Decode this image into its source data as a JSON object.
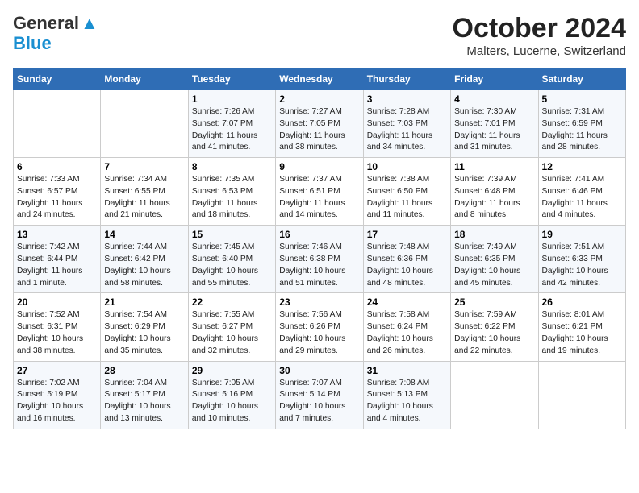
{
  "header": {
    "logo_line1": "General",
    "logo_line2": "Blue",
    "month": "October 2024",
    "location": "Malters, Lucerne, Switzerland"
  },
  "weekdays": [
    "Sunday",
    "Monday",
    "Tuesday",
    "Wednesday",
    "Thursday",
    "Friday",
    "Saturday"
  ],
  "weeks": [
    [
      {
        "num": "",
        "info": ""
      },
      {
        "num": "",
        "info": ""
      },
      {
        "num": "1",
        "info": "Sunrise: 7:26 AM\nSunset: 7:07 PM\nDaylight: 11 hours and 41 minutes."
      },
      {
        "num": "2",
        "info": "Sunrise: 7:27 AM\nSunset: 7:05 PM\nDaylight: 11 hours and 38 minutes."
      },
      {
        "num": "3",
        "info": "Sunrise: 7:28 AM\nSunset: 7:03 PM\nDaylight: 11 hours and 34 minutes."
      },
      {
        "num": "4",
        "info": "Sunrise: 7:30 AM\nSunset: 7:01 PM\nDaylight: 11 hours and 31 minutes."
      },
      {
        "num": "5",
        "info": "Sunrise: 7:31 AM\nSunset: 6:59 PM\nDaylight: 11 hours and 28 minutes."
      }
    ],
    [
      {
        "num": "6",
        "info": "Sunrise: 7:33 AM\nSunset: 6:57 PM\nDaylight: 11 hours and 24 minutes."
      },
      {
        "num": "7",
        "info": "Sunrise: 7:34 AM\nSunset: 6:55 PM\nDaylight: 11 hours and 21 minutes."
      },
      {
        "num": "8",
        "info": "Sunrise: 7:35 AM\nSunset: 6:53 PM\nDaylight: 11 hours and 18 minutes."
      },
      {
        "num": "9",
        "info": "Sunrise: 7:37 AM\nSunset: 6:51 PM\nDaylight: 11 hours and 14 minutes."
      },
      {
        "num": "10",
        "info": "Sunrise: 7:38 AM\nSunset: 6:50 PM\nDaylight: 11 hours and 11 minutes."
      },
      {
        "num": "11",
        "info": "Sunrise: 7:39 AM\nSunset: 6:48 PM\nDaylight: 11 hours and 8 minutes."
      },
      {
        "num": "12",
        "info": "Sunrise: 7:41 AM\nSunset: 6:46 PM\nDaylight: 11 hours and 4 minutes."
      }
    ],
    [
      {
        "num": "13",
        "info": "Sunrise: 7:42 AM\nSunset: 6:44 PM\nDaylight: 11 hours and 1 minute."
      },
      {
        "num": "14",
        "info": "Sunrise: 7:44 AM\nSunset: 6:42 PM\nDaylight: 10 hours and 58 minutes."
      },
      {
        "num": "15",
        "info": "Sunrise: 7:45 AM\nSunset: 6:40 PM\nDaylight: 10 hours and 55 minutes."
      },
      {
        "num": "16",
        "info": "Sunrise: 7:46 AM\nSunset: 6:38 PM\nDaylight: 10 hours and 51 minutes."
      },
      {
        "num": "17",
        "info": "Sunrise: 7:48 AM\nSunset: 6:36 PM\nDaylight: 10 hours and 48 minutes."
      },
      {
        "num": "18",
        "info": "Sunrise: 7:49 AM\nSunset: 6:35 PM\nDaylight: 10 hours and 45 minutes."
      },
      {
        "num": "19",
        "info": "Sunrise: 7:51 AM\nSunset: 6:33 PM\nDaylight: 10 hours and 42 minutes."
      }
    ],
    [
      {
        "num": "20",
        "info": "Sunrise: 7:52 AM\nSunset: 6:31 PM\nDaylight: 10 hours and 38 minutes."
      },
      {
        "num": "21",
        "info": "Sunrise: 7:54 AM\nSunset: 6:29 PM\nDaylight: 10 hours and 35 minutes."
      },
      {
        "num": "22",
        "info": "Sunrise: 7:55 AM\nSunset: 6:27 PM\nDaylight: 10 hours and 32 minutes."
      },
      {
        "num": "23",
        "info": "Sunrise: 7:56 AM\nSunset: 6:26 PM\nDaylight: 10 hours and 29 minutes."
      },
      {
        "num": "24",
        "info": "Sunrise: 7:58 AM\nSunset: 6:24 PM\nDaylight: 10 hours and 26 minutes."
      },
      {
        "num": "25",
        "info": "Sunrise: 7:59 AM\nSunset: 6:22 PM\nDaylight: 10 hours and 22 minutes."
      },
      {
        "num": "26",
        "info": "Sunrise: 8:01 AM\nSunset: 6:21 PM\nDaylight: 10 hours and 19 minutes."
      }
    ],
    [
      {
        "num": "27",
        "info": "Sunrise: 7:02 AM\nSunset: 5:19 PM\nDaylight: 10 hours and 16 minutes."
      },
      {
        "num": "28",
        "info": "Sunrise: 7:04 AM\nSunset: 5:17 PM\nDaylight: 10 hours and 13 minutes."
      },
      {
        "num": "29",
        "info": "Sunrise: 7:05 AM\nSunset: 5:16 PM\nDaylight: 10 hours and 10 minutes."
      },
      {
        "num": "30",
        "info": "Sunrise: 7:07 AM\nSunset: 5:14 PM\nDaylight: 10 hours and 7 minutes."
      },
      {
        "num": "31",
        "info": "Sunrise: 7:08 AM\nSunset: 5:13 PM\nDaylight: 10 hours and 4 minutes."
      },
      {
        "num": "",
        "info": ""
      },
      {
        "num": "",
        "info": ""
      }
    ]
  ]
}
